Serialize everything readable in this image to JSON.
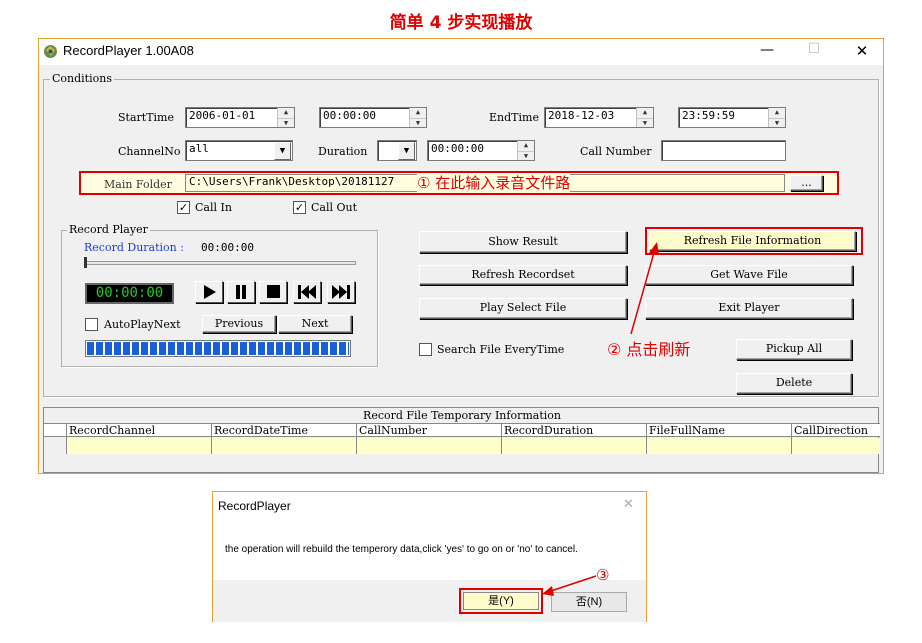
{
  "banner": "简单 4 步实现播放",
  "window": {
    "title": "RecordPlayer 1.00A08",
    "minimize": "—",
    "maximize": "☐",
    "close": "✕"
  },
  "conditions": {
    "group_label": "Conditions",
    "start_time_label": "StartTime",
    "start_date": "2006-01-01",
    "start_clock": "00:00:00",
    "end_time_label": "EndTime",
    "end_date": "2018-12-03",
    "end_clock": "23:59:59",
    "channel_label": "ChannelNo",
    "channel_value": "all",
    "duration_label": "Duration",
    "duration_op": "",
    "duration_value": "00:00:00",
    "call_number_label": "Call Number",
    "call_number_value": "",
    "main_folder_label": "Main Folder",
    "main_folder_value": "C:\\Users\\Frank\\Desktop\\20181127",
    "browse_label": "...",
    "call_in_label": "Call In",
    "call_out_label": "Call Out"
  },
  "annotations": {
    "step1": "① 在此输入录音文件路",
    "step2": "② 点击刷新",
    "step3": "③"
  },
  "record_player": {
    "group_label": "Record Player",
    "duration_label": "Record Duration :",
    "duration_value": "00:00:00",
    "lcd_time": "00:00:00",
    "autoplay_label": "AutoPlayNext",
    "previous_label": "Previous",
    "next_label": "Next"
  },
  "buttons": {
    "show_result": "Show Result",
    "refresh_file_info": "Refresh File Information",
    "refresh_recordset": "Refresh Recordset",
    "get_wave_file": "Get Wave File",
    "play_select_file": "Play Select File",
    "exit_player": "Exit Player",
    "search_every_time": "Search File EveryTime",
    "pickup_all": "Pickup All",
    "delete": "Delete"
  },
  "table": {
    "caption": "Record File Temporary Information",
    "columns": [
      "RecordChannel",
      "RecordDateTime",
      "CallNumber",
      "RecordDuration",
      "FileFullName",
      "CallDirection"
    ]
  },
  "dialog": {
    "title": "RecordPlayer",
    "close": "✕",
    "message": "the operation will rebuild the temperory data,click 'yes' to go on or 'no' to cancel.",
    "yes_label": "是(Y)",
    "no_label": "否(N)"
  },
  "colors": {
    "accent_red": "#e00000",
    "highlight_yellow": "#ffffcc",
    "lcd_background": "#000000",
    "lcd_text": "#22cc22",
    "progress_blue": "#1a5fd8"
  }
}
